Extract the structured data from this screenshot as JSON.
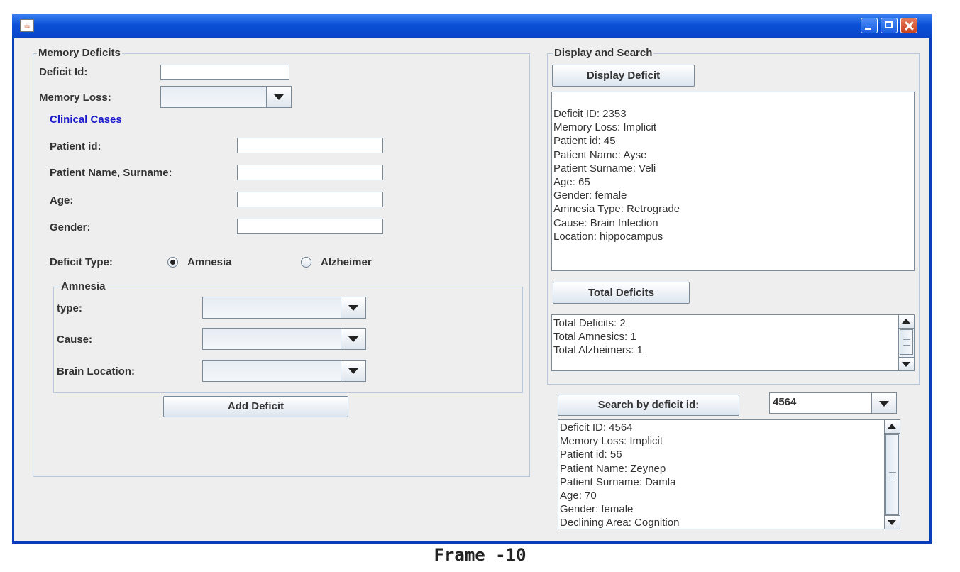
{
  "window": {
    "title": ""
  },
  "memory_deficits": {
    "group_title": "Memory Deficits",
    "deficit_id_label": "Deficit Id:",
    "deficit_id_value": "",
    "memory_loss_label": "Memory Loss:",
    "memory_loss_value": "",
    "clinical_cases_label": "Clinical Cases",
    "patient_id_label": "Patient id:",
    "patient_id_value": "",
    "patient_name_label": "Patient Name, Surname:",
    "patient_name_value": "",
    "age_label": "Age:",
    "age_value": "",
    "gender_label": "Gender:",
    "gender_value": "",
    "deficit_type_label": "Deficit Type:",
    "deficit_type_options": [
      "Amnesia",
      "Alzheimer"
    ],
    "deficit_type_selected": "Amnesia",
    "amnesia": {
      "group_title": "Amnesia",
      "type_label": "type:",
      "type_value": "",
      "cause_label": "Cause:",
      "cause_value": "",
      "brain_location_label": "Brain Location:",
      "brain_location_value": ""
    },
    "add_button": "Add Deficit"
  },
  "display_search": {
    "group_title": "Display and Search",
    "display_button": "Display Deficit",
    "display_lines": [
      "Deficit ID: 2353",
      "Memory Loss: Implicit",
      "Patient id: 45",
      "Patient Name: Ayse",
      "Patient Surname: Veli",
      "Age: 65",
      "Gender: female",
      "Amnesia Type: Retrograde",
      "Cause: Brain Infection",
      "Location: hippocampus"
    ],
    "total_button": "Total Deficits",
    "total_lines": [
      "Total Deficits: 2",
      "Total Amnesics: 1",
      "Total Alzheimers: 1"
    ],
    "search_button": "Search by deficit id:",
    "search_value": "4564",
    "search_lines": [
      "Deficit ID: 4564",
      "Memory Loss: Implicit",
      "Patient id: 56",
      "Patient Name: Zeynep",
      "Patient Surname: Damla",
      "Age: 70",
      "Gender: female",
      "Declining Area: Cognition"
    ]
  },
  "caption": "Frame -10"
}
